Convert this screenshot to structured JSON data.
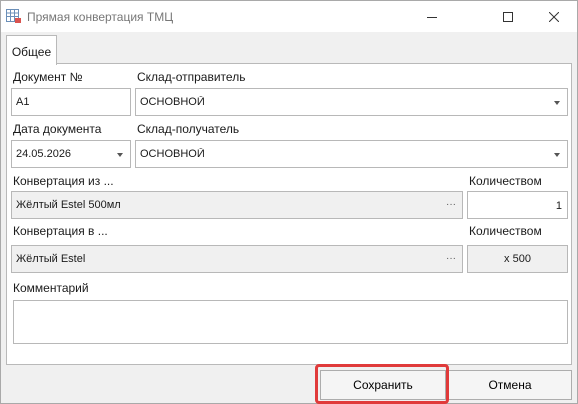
{
  "window": {
    "title": "Прямая конвертация ТМЦ",
    "app_icon": "table-document-icon",
    "controls": [
      "minimize-icon",
      "maximize-icon",
      "close-icon"
    ]
  },
  "tabs": [
    {
      "label": "Общее",
      "active": true
    }
  ],
  "form": {
    "document_number": {
      "label": "Документ №",
      "value": "А1"
    },
    "sender_warehouse": {
      "label": "Склад-отправитель",
      "value": "ОСНОВНОЙ"
    },
    "document_date": {
      "label": "Дата документа",
      "value": "24.05.2026"
    },
    "receiver_warehouse": {
      "label": "Склад-получатель",
      "value": "ОСНОВНОЙ"
    },
    "convert_from": {
      "label": "Конвертация из ...",
      "value": "Жёлтый Estel 500мл",
      "button": "···"
    },
    "from_quantity": {
      "label": "Количеством",
      "value": "1"
    },
    "convert_to": {
      "label": "Конвертация в ...",
      "value": "Жёлтый Estel",
      "button": "···"
    },
    "to_quantity": {
      "label": "Количеством",
      "value": "x 500"
    },
    "comment": {
      "label": "Комментарий",
      "value": ""
    }
  },
  "buttons": {
    "save": "Сохранить",
    "cancel": "Отмена"
  },
  "colors": {
    "highlight": "#e03a3a",
    "readonly_bg": "#f0f0f0",
    "border": "#b8b8b8"
  }
}
